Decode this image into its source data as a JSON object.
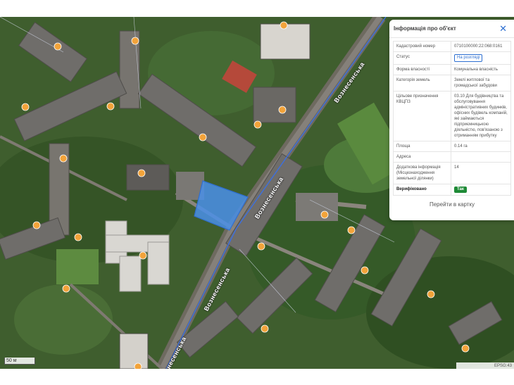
{
  "map": {
    "street_name": "Вознесенська",
    "scale_label": "50 м",
    "attribution": "EPSG:43",
    "colors": {
      "parcel_fill": "#4a8fe8",
      "parcel_stroke": "#2f6fd0",
      "road_line": "#3c6fe0",
      "marker": "#f2a33a"
    }
  },
  "panel": {
    "title": "Інформація про об'єкт",
    "close_icon": "close-icon",
    "rows": [
      {
        "key": "Кадастровий номер",
        "value": "0710100000:22:068:0161"
      },
      {
        "key": "Статус",
        "value": "На розгляді",
        "type": "badge"
      },
      {
        "key": "Форма власності",
        "value": "Комунальна власність"
      },
      {
        "key": "Категорія земель",
        "value": "Землі житлової та громадської забудови"
      },
      {
        "key": "Цільове призначення КВЦПЗ",
        "value": "03.10 Для будівництва та обслуговування адміністративних будинків, офісних будівель компаній, які займаються підприємницькою діяльністю, пов'язаною з отриманням прибутку"
      },
      {
        "key": "Площа",
        "value": "0.14 га"
      },
      {
        "key": "Адреса",
        "value": ""
      },
      {
        "key": "Додаткова інформація (Місцезнаходження земельної ділянки)",
        "value": "14"
      },
      {
        "key": "Верифіковано",
        "value": "Так",
        "type": "badge-green"
      }
    ],
    "card_link": "Перейти в картку"
  }
}
